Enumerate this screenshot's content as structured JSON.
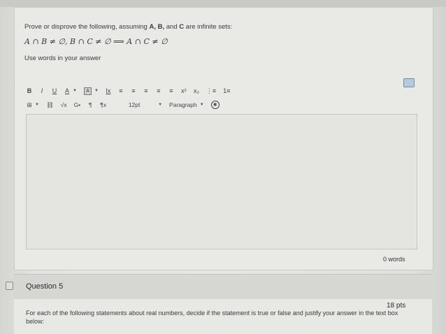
{
  "question4": {
    "prompt_prefix": "Prove or disprove the following, assuming ",
    "prompt_vars": "A, B,",
    "prompt_and": " and ",
    "prompt_c": "C",
    "prompt_suffix": " are infinite sets:",
    "math": "A ∩ B ≠ ∅,  B ∩ C ≠ ∅  ⟹  A ∩ C ≠ ∅",
    "hint": "Use words in your answer"
  },
  "toolbar": {
    "row1": [
      "B",
      "I",
      "U",
      "A",
      "A",
      "Ix",
      "≡",
      "≡",
      "≡",
      "≡",
      "≡",
      "x²",
      "x₂",
      "⋮≡",
      "1≡"
    ],
    "row2_font_size": "12pt",
    "row2_paragraph": "Paragraph",
    "row2_icons": [
      "table",
      "link",
      "√x",
      "embed",
      "¶",
      "¶x"
    ]
  },
  "editor": {
    "word_count": "0 words"
  },
  "question5": {
    "title": "Question 5",
    "points": "18 pts",
    "text": "For each of the following statements about real numbers, decide if the statement is true or false and justify your answer in the text box below:"
  }
}
